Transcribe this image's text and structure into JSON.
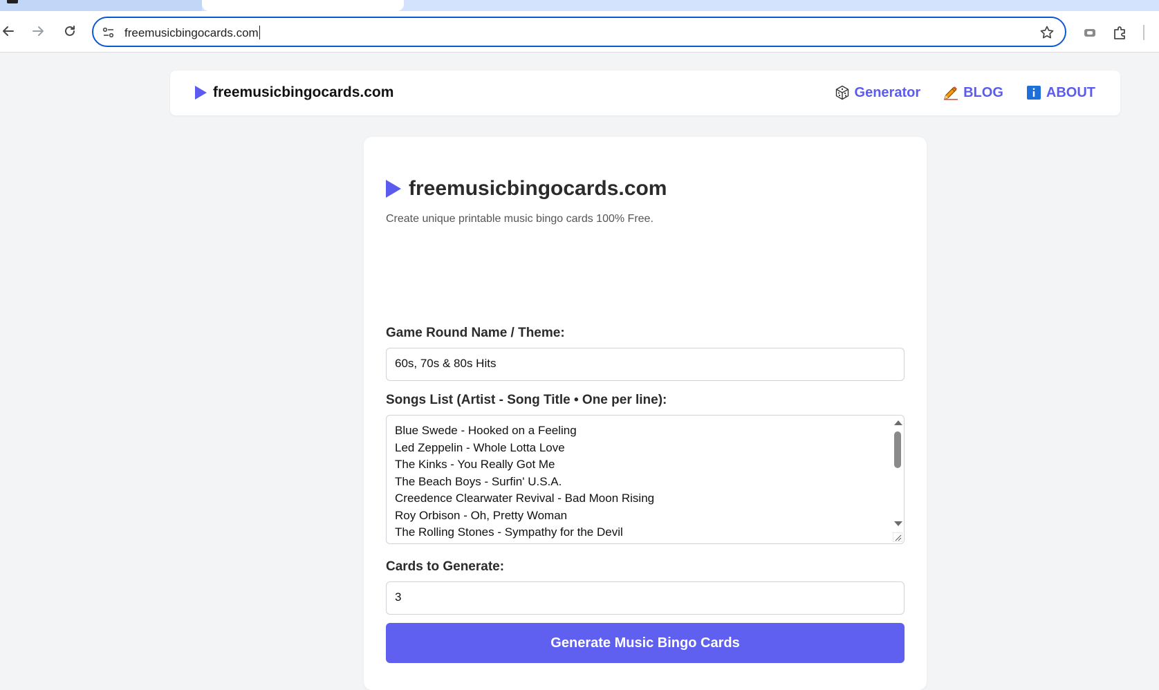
{
  "browser": {
    "url": "freemusicbingocards.com",
    "icons": [
      "back-arrow-icon",
      "forward-arrow-icon",
      "reload-icon",
      "site-settings-icon",
      "bookmark-star-icon",
      "media-icon",
      "extensions-puzzle-icon"
    ]
  },
  "header": {
    "brand": "freemusicbingocards.com",
    "nav": [
      {
        "label": "Generator",
        "icon": "dice-icon"
      },
      {
        "label": "BLOG",
        "icon": "pencil-icon"
      },
      {
        "label": "ABOUT",
        "icon": "info-icon"
      }
    ]
  },
  "main": {
    "title": "freemusicbingocards.com",
    "subtitle": "Create unique printable music bingo cards 100% Free.",
    "round_name": {
      "label": "Game Round Name / Theme:",
      "value": "60s, 70s & 80s Hits"
    },
    "songs": {
      "label": "Songs List (Artist - Song Title • One per line):",
      "items": [
        "Blue Swede - Hooked on a Feeling",
        "Led Zeppelin - Whole Lotta Love",
        "The Kinks - You Really Got Me",
        "The Beach Boys - Surfin' U.S.A.",
        "Creedence Clearwater Revival - Bad Moon Rising",
        "Roy Orbison - Oh, Pretty Woman",
        "The Rolling Stones - Sympathy for the Devil"
      ]
    },
    "cards": {
      "label": "Cards to Generate:",
      "value": "3"
    },
    "generate_label": "Generate Music Bingo Cards"
  },
  "colors": {
    "accent": "#5b5bf0",
    "button": "#6060f0",
    "omnibox_border": "#0b57d0",
    "page_bg": "#f3f4f6"
  }
}
